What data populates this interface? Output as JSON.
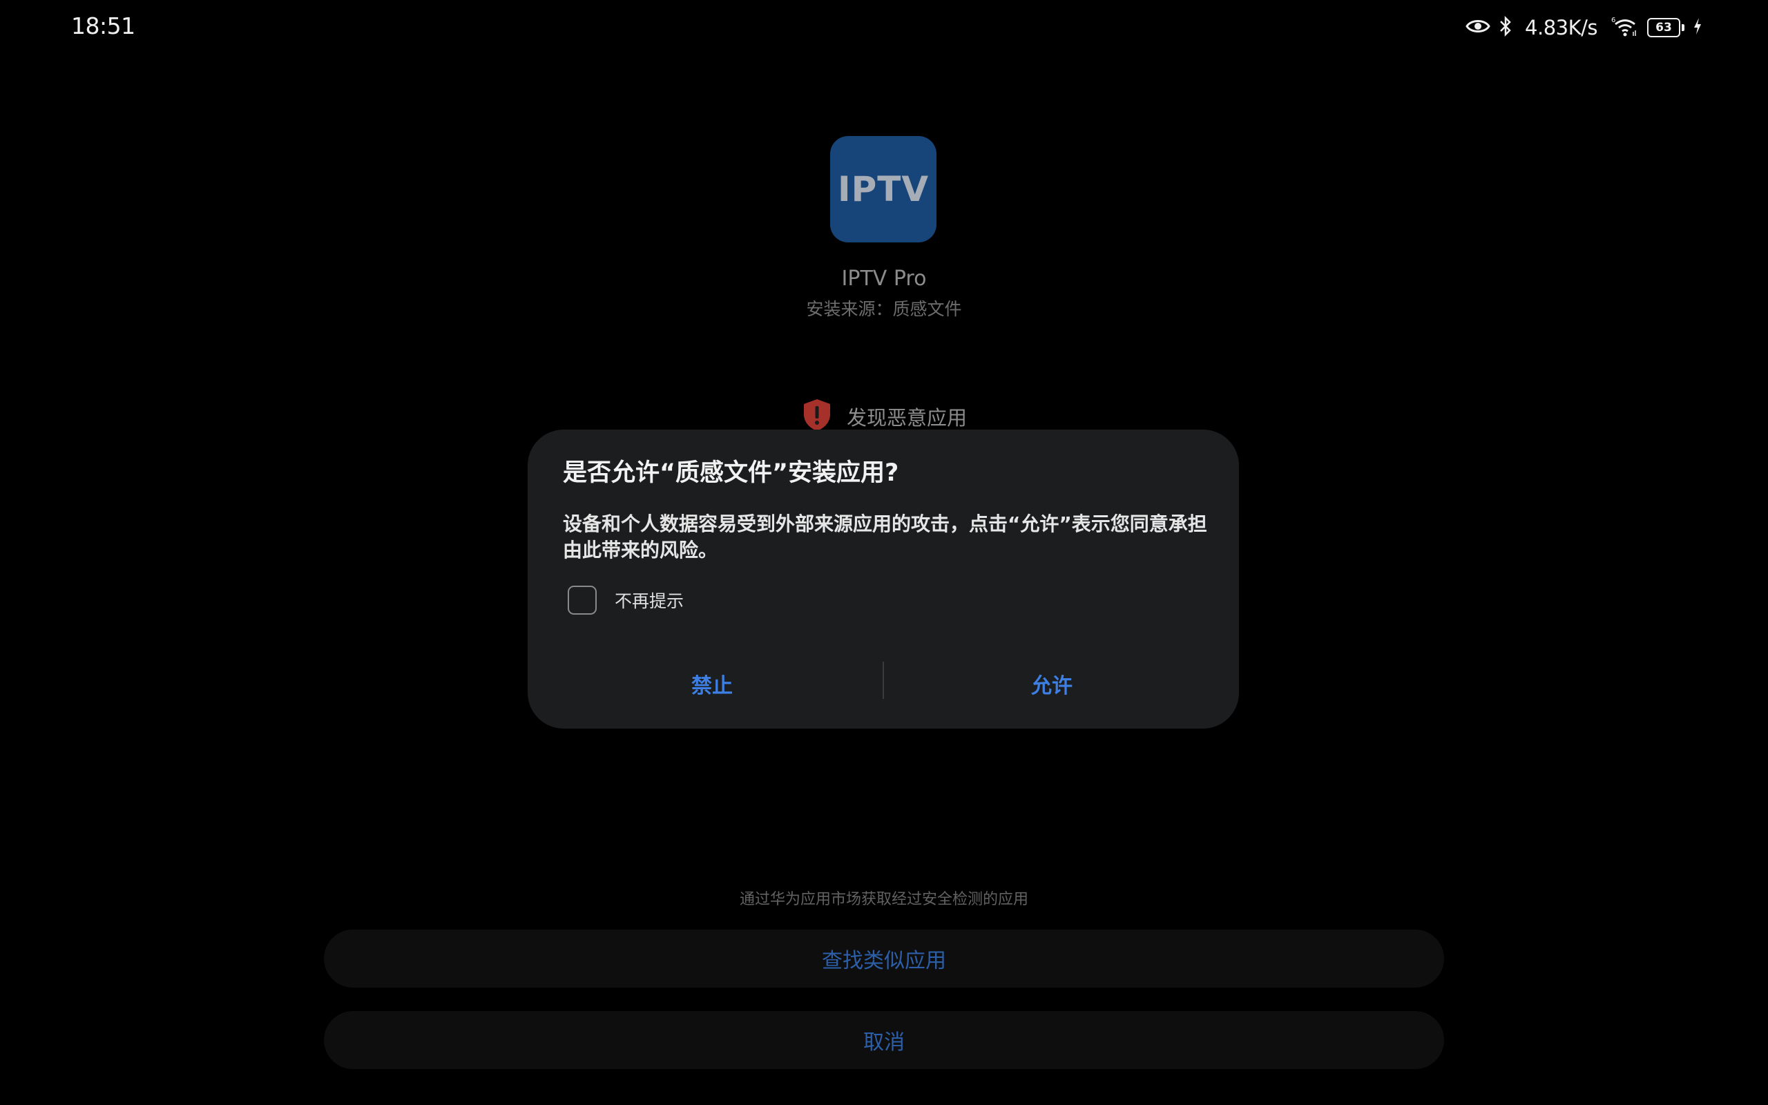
{
  "status_bar": {
    "time": "18:51",
    "net_speed": "4.83K/s",
    "battery": "63",
    "icons": [
      "eye-icon",
      "bluetooth-icon",
      "wifi-6-icon",
      "battery-icon",
      "charging-icon"
    ]
  },
  "app": {
    "icon_text": "IPTV",
    "name": "IPTV Pro",
    "source": "安装来源：质感文件",
    "icon_color": "#174579"
  },
  "warning": {
    "label": "发现恶意应用",
    "icon": "shield-alert-icon",
    "color": "#b3322c"
  },
  "dialog": {
    "title": "是否允许“质感文件”安装应用?",
    "body": "设备和个人数据容易受到外部来源应用的攻击，点击“允许”表示您同意承担由此带来的风险。",
    "checkbox_label": "不再提示",
    "deny_label": "禁止",
    "allow_label": "允许",
    "accent_color": "#3d7fe3"
  },
  "footer": {
    "market_note": "通过华为应用市场获取经过安全检测的应用",
    "find_similar_label": "查找类似应用",
    "cancel_label": "取消"
  }
}
